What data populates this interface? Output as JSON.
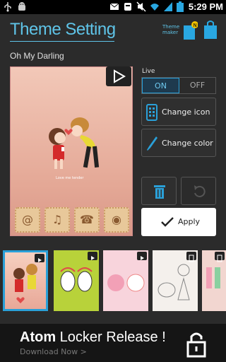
{
  "status_bar": {
    "time": "5:29 PM"
  },
  "header": {
    "title": "Theme Setting",
    "theme_maker_label_1": "Theme",
    "theme_maker_label_2": "maker"
  },
  "theme_name": "Oh My Darling",
  "preview": {
    "caption": "Love me tender"
  },
  "live": {
    "label": "Live",
    "on_label": "ON",
    "off_label": "OFF",
    "selected": "ON"
  },
  "actions": {
    "change_icon": "Change icon",
    "change_color": "Change color",
    "apply": "Apply"
  },
  "colors": {
    "accent": "#2aa0d8",
    "title": "#5fc4e8"
  },
  "thumbnails": [
    {
      "name": "kissing-couple-theme",
      "selected": true,
      "badge": "play"
    },
    {
      "name": "green-faces-theme",
      "selected": false,
      "badge": "play"
    },
    {
      "name": "pink-bunny-theme",
      "selected": false,
      "badge": "play"
    },
    {
      "name": "sketch-animals-theme",
      "selected": false,
      "badge": "phone"
    },
    {
      "name": "couple-pink-theme",
      "selected": false,
      "badge": "phone"
    }
  ],
  "banner": {
    "title_bold": "Atom",
    "title_rest": " Locker Release !",
    "subtitle": "Download Now >"
  }
}
